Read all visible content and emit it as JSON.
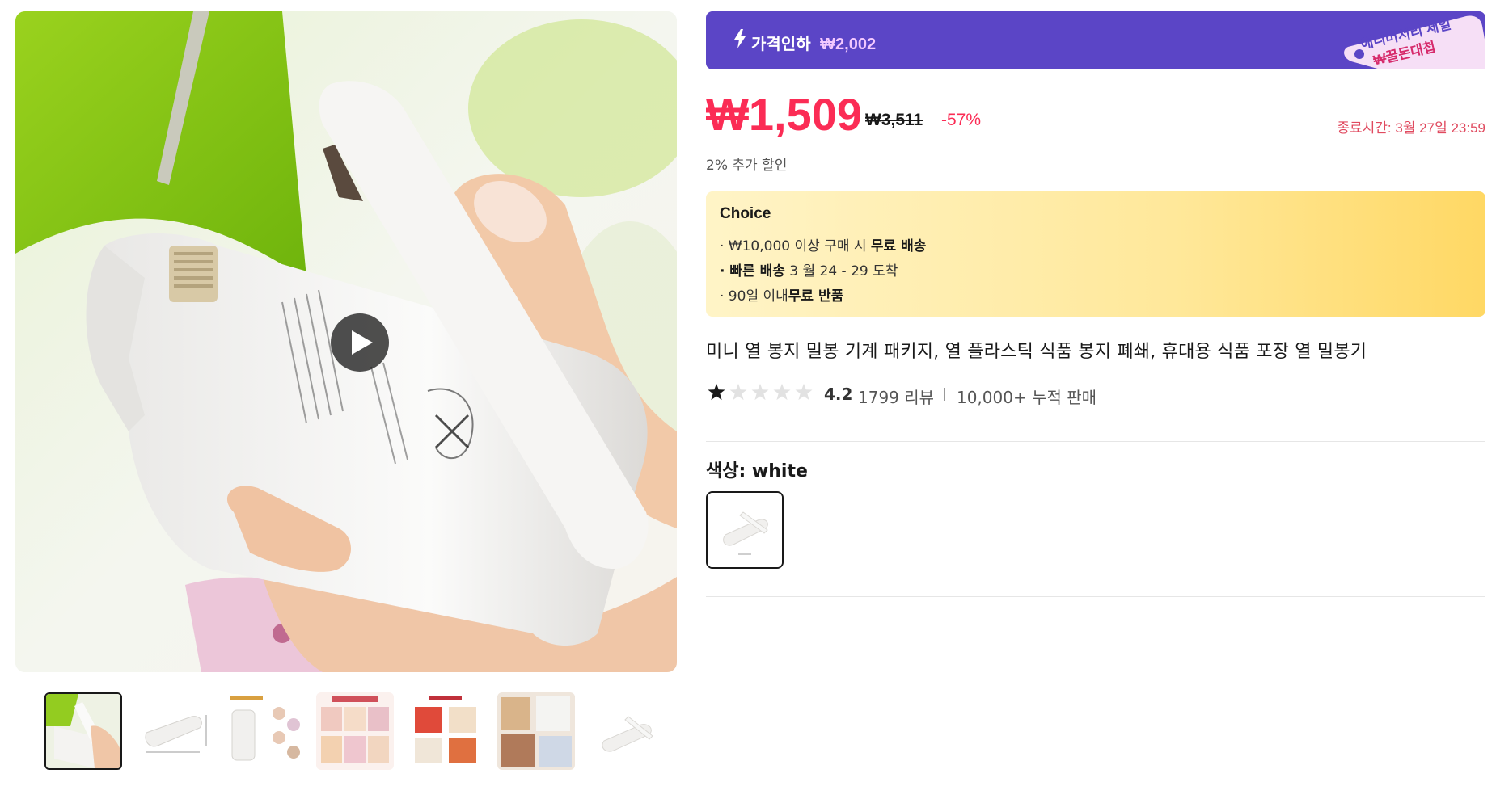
{
  "gallery": {
    "main_image_alt": "",
    "thumbnail_count": 7,
    "active_thumbnail": 1,
    "thumbnails": [
      {
        "icon": "photo-sealer-in-hand"
      },
      {
        "icon": "photo-sealer-dimensions"
      },
      {
        "icon": "photo-how-to-use"
      },
      {
        "icon": "photo-steps-for-usage"
      },
      {
        "icon": "photo-effect-display"
      },
      {
        "icon": "photo-food-bags"
      },
      {
        "icon": "photo-sealer-white"
      }
    ]
  },
  "promo": {
    "label": "가격인하",
    "amount": "₩2,002",
    "badge_line1": "애니버서리 세일",
    "badge_line2": "₩꿀돈대첩",
    "color": "#5b45c6"
  },
  "price": {
    "current": "₩1,509",
    "original": "₩3,511",
    "discount": "-57%",
    "end_time": "종료시간: 3월 27일 23:59",
    "extra_discount": "2% 추가 할인",
    "color": "#fb2c55"
  },
  "choice": {
    "title": "Choice",
    "line1_prefix": "· ₩10,000 이상 구매 시 ",
    "line1_bold": "무료 배송",
    "line2_bold": "· 빠른 배송",
    "line2_suffix": " 3 월 24 - 29 도착",
    "line3_prefix": "· 90일 이내",
    "line3_bold": "무료 반품"
  },
  "product": {
    "title": "미니 열 봉지 밀봉 기계 패키지, 열 플라스틱 식품 봉지 폐쇄, 휴대용 식품 포장 열 밀봉기",
    "rating": "4.2",
    "rating_value": 4.2,
    "reviews": "1799 리뷰",
    "sales": "10,000+ 누적 판매"
  },
  "color_option": {
    "label": "색상: white",
    "selected": "white"
  }
}
